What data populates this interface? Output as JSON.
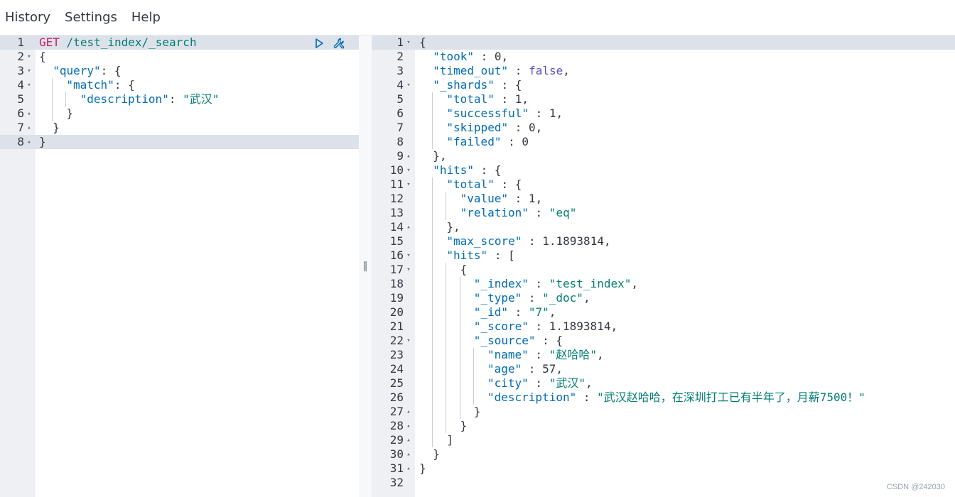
{
  "menu": {
    "history": "History",
    "settings": "Settings",
    "help": "Help"
  },
  "request": {
    "method": "GET",
    "path": "/test_index/_search",
    "lines": [
      {
        "n": "1",
        "fold": "",
        "indent": 0,
        "parts": [
          [
            "m",
            "GET"
          ],
          [
            "n",
            " "
          ],
          [
            "u",
            "/test_index/_search"
          ]
        ]
      },
      {
        "n": "2",
        "fold": "down",
        "indent": 0,
        "parts": [
          [
            "n",
            "{"
          ]
        ]
      },
      {
        "n": "3",
        "fold": "down",
        "indent": 1,
        "parts": [
          [
            "k",
            "\"query\""
          ],
          [
            "n",
            ": {"
          ]
        ]
      },
      {
        "n": "4",
        "fold": "down",
        "indent": 2,
        "parts": [
          [
            "k",
            "\"match\""
          ],
          [
            "n",
            ": {"
          ]
        ]
      },
      {
        "n": "5",
        "fold": "",
        "indent": 3,
        "parts": [
          [
            "k",
            "\"description\""
          ],
          [
            "n",
            ": "
          ],
          [
            "s",
            "\"武汉\""
          ]
        ]
      },
      {
        "n": "6",
        "fold": "up",
        "indent": 2,
        "parts": [
          [
            "n",
            "}"
          ]
        ]
      },
      {
        "n": "7",
        "fold": "up",
        "indent": 1,
        "parts": [
          [
            "n",
            "}"
          ]
        ]
      },
      {
        "n": "8",
        "fold": "up",
        "indent": 0,
        "parts": [
          [
            "n",
            "}"
          ]
        ]
      }
    ]
  },
  "response": {
    "lines": [
      {
        "n": "1",
        "fold": "down",
        "indent": 0,
        "parts": [
          [
            "n",
            "{"
          ]
        ]
      },
      {
        "n": "2",
        "fold": "",
        "indent": 1,
        "parts": [
          [
            "k",
            "\"took\""
          ],
          [
            "n",
            " : 0,"
          ]
        ]
      },
      {
        "n": "3",
        "fold": "",
        "indent": 1,
        "parts": [
          [
            "k",
            "\"timed_out\""
          ],
          [
            "n",
            " : "
          ],
          [
            "b",
            "false"
          ],
          [
            "n",
            ","
          ]
        ]
      },
      {
        "n": "4",
        "fold": "down",
        "indent": 1,
        "parts": [
          [
            "k",
            "\"_shards\""
          ],
          [
            "n",
            " : {"
          ]
        ]
      },
      {
        "n": "5",
        "fold": "",
        "indent": 2,
        "parts": [
          [
            "k",
            "\"total\""
          ],
          [
            "n",
            " : 1,"
          ]
        ]
      },
      {
        "n": "6",
        "fold": "",
        "indent": 2,
        "parts": [
          [
            "k",
            "\"successful\""
          ],
          [
            "n",
            " : 1,"
          ]
        ]
      },
      {
        "n": "7",
        "fold": "",
        "indent": 2,
        "parts": [
          [
            "k",
            "\"skipped\""
          ],
          [
            "n",
            " : 0,"
          ]
        ]
      },
      {
        "n": "8",
        "fold": "",
        "indent": 2,
        "parts": [
          [
            "k",
            "\"failed\""
          ],
          [
            "n",
            " : 0"
          ]
        ]
      },
      {
        "n": "9",
        "fold": "up",
        "indent": 1,
        "parts": [
          [
            "n",
            "},"
          ]
        ]
      },
      {
        "n": "10",
        "fold": "down",
        "indent": 1,
        "parts": [
          [
            "k",
            "\"hits\""
          ],
          [
            "n",
            " : {"
          ]
        ]
      },
      {
        "n": "11",
        "fold": "down",
        "indent": 2,
        "parts": [
          [
            "k",
            "\"total\""
          ],
          [
            "n",
            " : {"
          ]
        ]
      },
      {
        "n": "12",
        "fold": "",
        "indent": 3,
        "parts": [
          [
            "k",
            "\"value\""
          ],
          [
            "n",
            " : 1,"
          ]
        ]
      },
      {
        "n": "13",
        "fold": "",
        "indent": 3,
        "parts": [
          [
            "k",
            "\"relation\""
          ],
          [
            "n",
            " : "
          ],
          [
            "s",
            "\"eq\""
          ]
        ]
      },
      {
        "n": "14",
        "fold": "up",
        "indent": 2,
        "parts": [
          [
            "n",
            "},"
          ]
        ]
      },
      {
        "n": "15",
        "fold": "",
        "indent": 2,
        "parts": [
          [
            "k",
            "\"max_score\""
          ],
          [
            "n",
            " : 1.1893814,"
          ]
        ]
      },
      {
        "n": "16",
        "fold": "down",
        "indent": 2,
        "parts": [
          [
            "k",
            "\"hits\""
          ],
          [
            "n",
            " : ["
          ]
        ]
      },
      {
        "n": "17",
        "fold": "down",
        "indent": 3,
        "parts": [
          [
            "n",
            "{"
          ]
        ]
      },
      {
        "n": "18",
        "fold": "",
        "indent": 4,
        "parts": [
          [
            "k",
            "\"_index\""
          ],
          [
            "n",
            " : "
          ],
          [
            "s",
            "\"test_index\""
          ],
          [
            "n",
            ","
          ]
        ]
      },
      {
        "n": "19",
        "fold": "",
        "indent": 4,
        "parts": [
          [
            "k",
            "\"_type\""
          ],
          [
            "n",
            " : "
          ],
          [
            "s",
            "\"_doc\""
          ],
          [
            "n",
            ","
          ]
        ]
      },
      {
        "n": "20",
        "fold": "",
        "indent": 4,
        "parts": [
          [
            "k",
            "\"_id\""
          ],
          [
            "n",
            " : "
          ],
          [
            "s",
            "\"7\""
          ],
          [
            "n",
            ","
          ]
        ]
      },
      {
        "n": "21",
        "fold": "",
        "indent": 4,
        "parts": [
          [
            "k",
            "\"_score\""
          ],
          [
            "n",
            " : 1.1893814,"
          ]
        ]
      },
      {
        "n": "22",
        "fold": "down",
        "indent": 4,
        "parts": [
          [
            "k",
            "\"_source\""
          ],
          [
            "n",
            " : {"
          ]
        ]
      },
      {
        "n": "23",
        "fold": "",
        "indent": 5,
        "parts": [
          [
            "k",
            "\"name\""
          ],
          [
            "n",
            " : "
          ],
          [
            "s",
            "\"赵哈哈\""
          ],
          [
            "n",
            ","
          ]
        ]
      },
      {
        "n": "24",
        "fold": "",
        "indent": 5,
        "parts": [
          [
            "k",
            "\"age\""
          ],
          [
            "n",
            " : 57,"
          ]
        ]
      },
      {
        "n": "25",
        "fold": "",
        "indent": 5,
        "parts": [
          [
            "k",
            "\"city\""
          ],
          [
            "n",
            " : "
          ],
          [
            "s",
            "\"武汉\""
          ],
          [
            "n",
            ","
          ]
        ]
      },
      {
        "n": "26",
        "fold": "",
        "indent": 5,
        "parts": [
          [
            "k",
            "\"description\""
          ],
          [
            "n",
            " : "
          ],
          [
            "s",
            "\"武汉赵哈哈，在深圳打工已有半年了，月薪7500！\""
          ]
        ]
      },
      {
        "n": "27",
        "fold": "up",
        "indent": 4,
        "parts": [
          [
            "n",
            "}"
          ]
        ]
      },
      {
        "n": "28",
        "fold": "up",
        "indent": 3,
        "parts": [
          [
            "n",
            "}"
          ]
        ]
      },
      {
        "n": "29",
        "fold": "up",
        "indent": 2,
        "parts": [
          [
            "n",
            "]"
          ]
        ]
      },
      {
        "n": "30",
        "fold": "up",
        "indent": 1,
        "parts": [
          [
            "n",
            "}"
          ]
        ]
      },
      {
        "n": "31",
        "fold": "up",
        "indent": 0,
        "parts": [
          [
            "n",
            "}"
          ]
        ]
      },
      {
        "n": "32",
        "fold": "",
        "indent": 0,
        "parts": []
      }
    ]
  },
  "splitter": {
    "grip": "‖"
  },
  "watermark": "CSDN @242030"
}
